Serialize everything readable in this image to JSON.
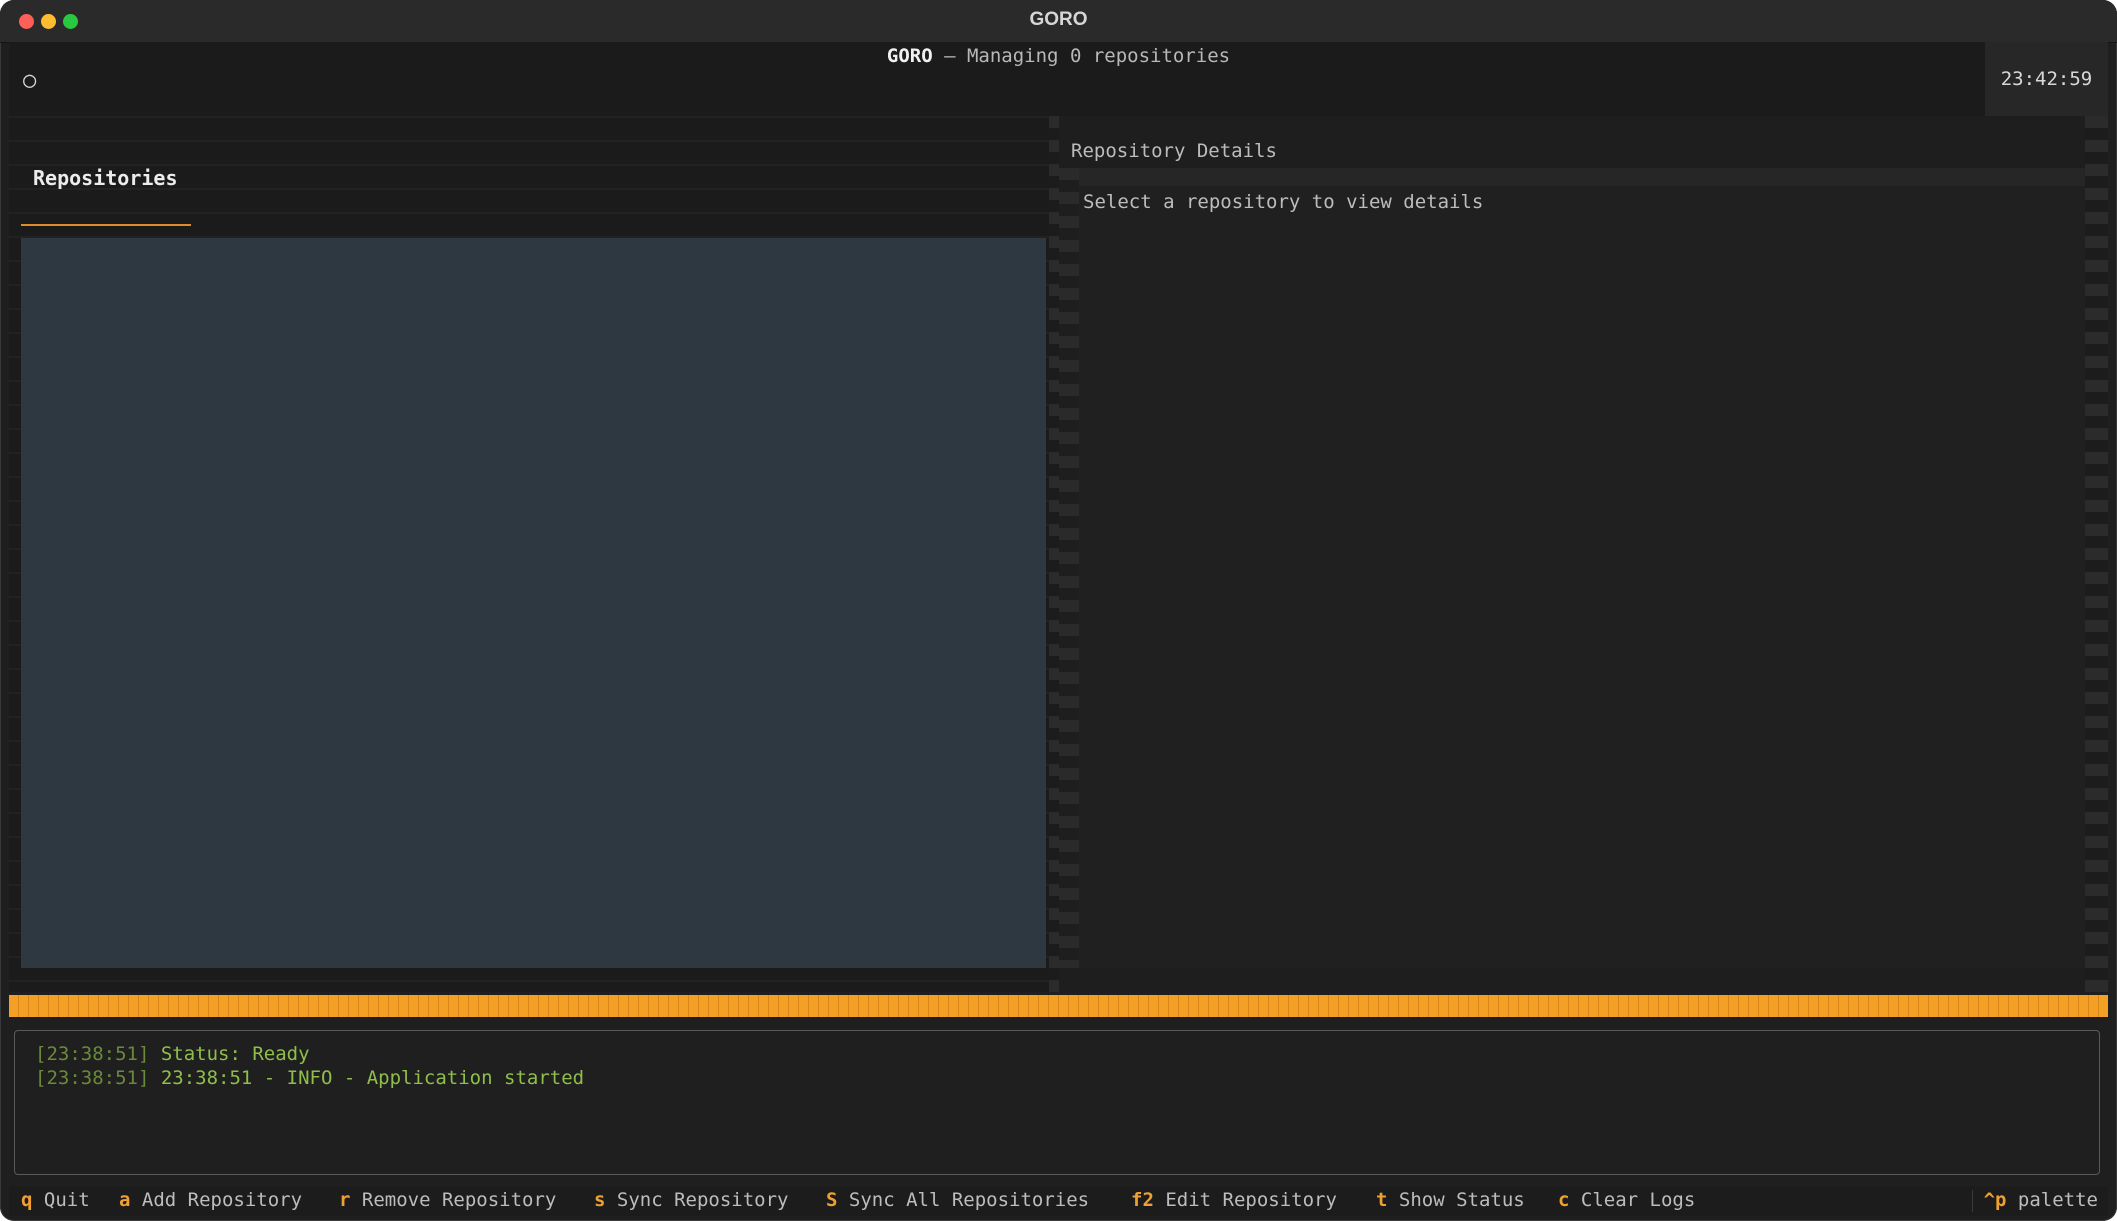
{
  "window": {
    "title": "GORO"
  },
  "header": {
    "icon": "○",
    "app_name": "GORO",
    "subtitle": " — Managing 0 repositories",
    "clock": "23:42:59"
  },
  "repositories_panel": {
    "tab_label": "Repositories",
    "items": []
  },
  "details_panel": {
    "title": "Repository Details",
    "placeholder": "Select a repository to view details"
  },
  "logs": [
    {
      "timestamp": "[23:38:51]",
      "message": " Status: Ready"
    },
    {
      "timestamp": "[23:38:51]",
      "message": " 23:38:51 - INFO - Application started"
    }
  ],
  "footer": {
    "bindings": [
      {
        "key": "q",
        "label": " Quit"
      },
      {
        "key": "a",
        "label": " Add Repository"
      },
      {
        "key": "r",
        "label": " Remove Repository"
      },
      {
        "key": "s",
        "label": " Sync Repository"
      },
      {
        "key": "S",
        "label": " Sync All Repositories"
      },
      {
        "key": "f2",
        "label": " Edit Repository"
      },
      {
        "key": "t",
        "label": " Show Status"
      },
      {
        "key": "c",
        "label": " Clear Logs"
      }
    ],
    "palette": {
      "key": "^p",
      "label": " palette"
    }
  },
  "colors": {
    "accent": "#f4a024",
    "list_background": "#2e3841",
    "log_text": "#8fbf4a"
  }
}
